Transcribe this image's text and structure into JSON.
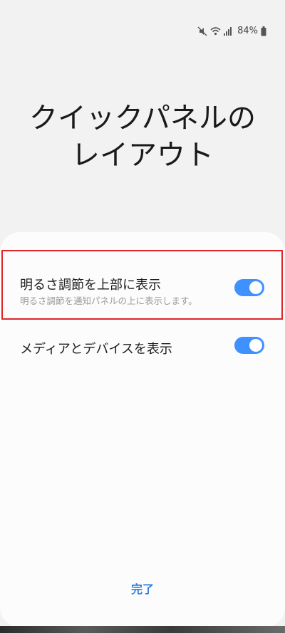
{
  "status_bar": {
    "battery_percent": "84%",
    "icons": [
      "mute-icon",
      "wifi-icon",
      "signal-icon",
      "battery-icon"
    ]
  },
  "page": {
    "title": "クイックパネルの\nレイアウト"
  },
  "settings": [
    {
      "label": "明るさ調節を上部に表示",
      "description": "明るさ調節を通知パネルの上に表示します。",
      "enabled": true
    },
    {
      "label": "メディアとデバイスを表示",
      "enabled": true
    }
  ],
  "actions": {
    "done_label": "完了"
  },
  "colors": {
    "accent": "#3e91ff",
    "done_text": "#2f7ee0",
    "highlight": "#e0262a"
  }
}
